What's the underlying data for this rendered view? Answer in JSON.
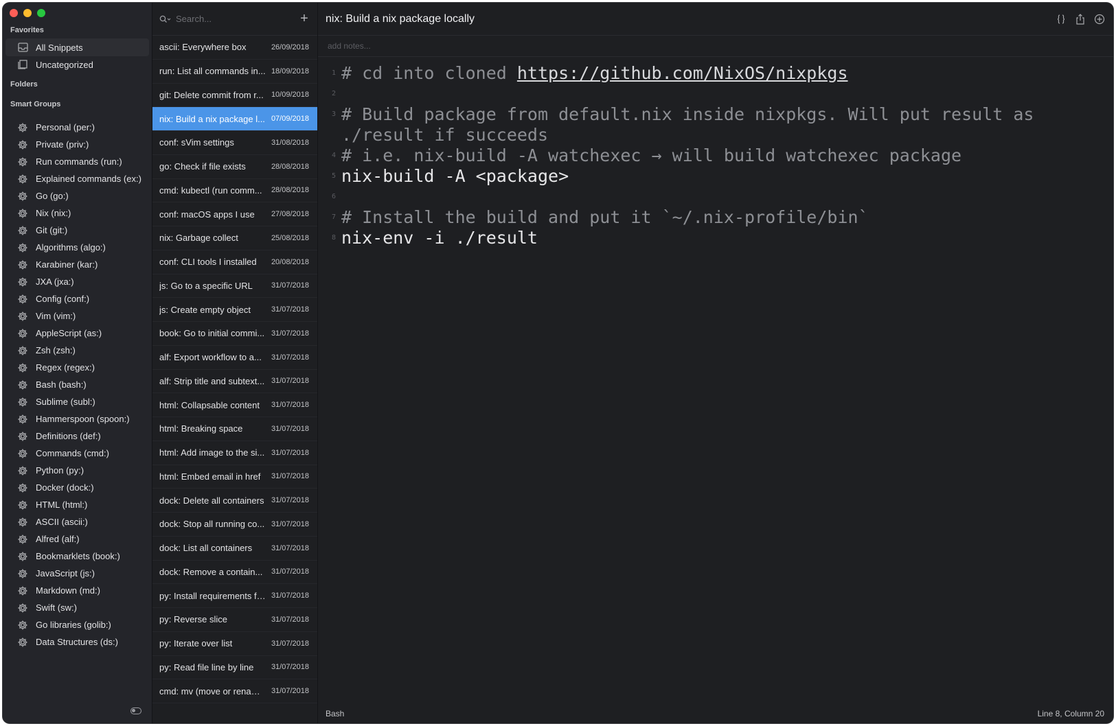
{
  "sidebar": {
    "favorites_heading": "Favorites",
    "favorites": [
      {
        "label": "All Snippets",
        "icon": "tray-icon"
      },
      {
        "label": "Uncategorized",
        "icon": "document-icon"
      }
    ],
    "folders_heading": "Folders",
    "smart_groups_heading": "Smart Groups",
    "smart_groups": [
      "Personal (per:)",
      "Private (priv:)",
      "Run commands (run:)",
      "Explained commands (ex:)",
      "Go (go:)",
      "Nix (nix:)",
      "Git (git:)",
      "Algorithms (algo:)",
      "Karabiner (kar:)",
      "JXA (jxa:)",
      "Config (conf:)",
      "Vim (vim:)",
      "AppleScript (as:)",
      "Zsh (zsh:)",
      "Regex (regex:)",
      "Bash (bash:)",
      "Sublime (subl:)",
      "Hammerspoon (spoon:)",
      "Definitions (def:)",
      "Commands (cmd:)",
      "Python (py:)",
      "Docker (dock:)",
      "HTML (html:)",
      "ASCII (ascii:)",
      "Alfred (alf:)",
      "Bookmarklets (book:)",
      "JavaScript (js:)",
      "Markdown (md:)",
      "Swift (sw:)",
      "Go libraries (golib:)",
      "Data Structures (ds:)"
    ]
  },
  "search": {
    "placeholder": "Search..."
  },
  "snippets": [
    {
      "title": "ascii: Everywhere box",
      "date": "26/09/2018"
    },
    {
      "title": "run: List all commands in...",
      "date": "18/09/2018"
    },
    {
      "title": "git: Delete commit from r...",
      "date": "10/09/2018"
    },
    {
      "title": "nix: Build a nix package l...",
      "date": "07/09/2018",
      "selected": true
    },
    {
      "title": "conf: sVim settings",
      "date": "31/08/2018"
    },
    {
      "title": "go: Check if file exists",
      "date": "28/08/2018"
    },
    {
      "title": "cmd: kubectl (run comm...",
      "date": "28/08/2018"
    },
    {
      "title": "conf: macOS apps I use",
      "date": "27/08/2018"
    },
    {
      "title": "nix: Garbage collect",
      "date": "25/08/2018"
    },
    {
      "title": "conf: CLI tools I installed",
      "date": "20/08/2018"
    },
    {
      "title": "js: Go to a specific URL",
      "date": "31/07/2018"
    },
    {
      "title": "js: Create empty object",
      "date": "31/07/2018"
    },
    {
      "title": "book: Go to initial commi...",
      "date": "31/07/2018"
    },
    {
      "title": "alf: Export workflow to a...",
      "date": "31/07/2018"
    },
    {
      "title": "alf: Strip title and subtext...",
      "date": "31/07/2018"
    },
    {
      "title": "html: Collapsable content",
      "date": "31/07/2018"
    },
    {
      "title": "html: Breaking space",
      "date": "31/07/2018"
    },
    {
      "title": "html: Add image to the si...",
      "date": "31/07/2018"
    },
    {
      "title": "html: Embed email in href",
      "date": "31/07/2018"
    },
    {
      "title": "dock: Delete all containers",
      "date": "31/07/2018"
    },
    {
      "title": "dock: Stop all running co...",
      "date": "31/07/2018"
    },
    {
      "title": "dock: List all containers",
      "date": "31/07/2018"
    },
    {
      "title": "dock: Remove a contain...",
      "date": "31/07/2018"
    },
    {
      "title": "py: Install requirements fr...",
      "date": "31/07/2018"
    },
    {
      "title": "py: Reverse slice",
      "date": "31/07/2018"
    },
    {
      "title": "py: Iterate over list",
      "date": "31/07/2018"
    },
    {
      "title": "py: Read file line by line",
      "date": "31/07/2018"
    },
    {
      "title": "cmd: mv (move or renam...",
      "date": "31/07/2018"
    }
  ],
  "editor": {
    "title": "nix: Build a nix package locally",
    "notes_placeholder": "add notes...",
    "lines": [
      {
        "num": "1",
        "kind": "comment",
        "text": "# cd into cloned ",
        "link": "https://github.com/NixOS/nixpkgs"
      },
      {
        "num": "2",
        "kind": "blank",
        "text": ""
      },
      {
        "num": "3",
        "kind": "comment",
        "text": "# Build package from default.nix inside nixpkgs. Will put result as ./result if succeeds"
      },
      {
        "num": "4",
        "kind": "comment",
        "text": "# i.e. nix-build -A watchexec → will build watchexec package"
      },
      {
        "num": "5",
        "kind": "cmd",
        "text": "nix-build -A <package>"
      },
      {
        "num": "6",
        "kind": "blank",
        "text": ""
      },
      {
        "num": "7",
        "kind": "comment",
        "text": "# Install the build and put it `~/.nix-profile/bin`"
      },
      {
        "num": "8",
        "kind": "cmd",
        "text": "nix-env -i ./result"
      }
    ],
    "language": "Bash",
    "cursor": "Line 8, Column 20"
  },
  "colors": {
    "accent": "#4b95e8",
    "background": "#1e1f22",
    "sidebar": "#24252a"
  }
}
